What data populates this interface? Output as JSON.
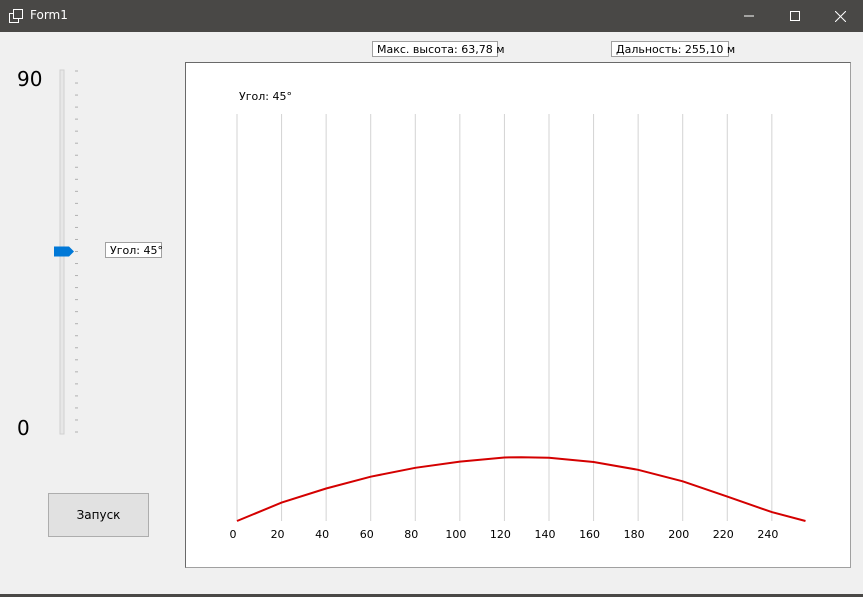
{
  "window": {
    "title": "Form1"
  },
  "labels": {
    "max_height": "Макс. высота: 63,78 м",
    "range": "Дальность: 255,10 м",
    "angle_slider": "Угол: 45°",
    "angle_plot": "Угол: 45°"
  },
  "slider": {
    "max_label": "90",
    "min_label": "0",
    "min": 0,
    "max": 90,
    "value": 45
  },
  "launch_button": {
    "label": "Запуск"
  },
  "colors": {
    "titlebar": "#494846",
    "trajectory": "#d40000",
    "slider_thumb": "#0078d7"
  },
  "chart_data": {
    "type": "line",
    "title": "",
    "xlabel": "",
    "ylabel": "",
    "xlim": [
      0,
      255.1
    ],
    "x_ticks": [
      0,
      20,
      40,
      60,
      80,
      100,
      120,
      140,
      160,
      180,
      200,
      220,
      240
    ],
    "series": [
      {
        "values_x": [
          0,
          20,
          40,
          60,
          80,
          100,
          120,
          127.55,
          140,
          160,
          180,
          200,
          220,
          240,
          255.1
        ],
        "values_y": [
          0,
          18.4,
          32.5,
          44.3,
          53.2,
          59.4,
          63.5,
          63.78,
          63.2,
          59.0,
          51.2,
          39.7,
          24.4,
          8.9,
          0
        ]
      }
    ]
  }
}
